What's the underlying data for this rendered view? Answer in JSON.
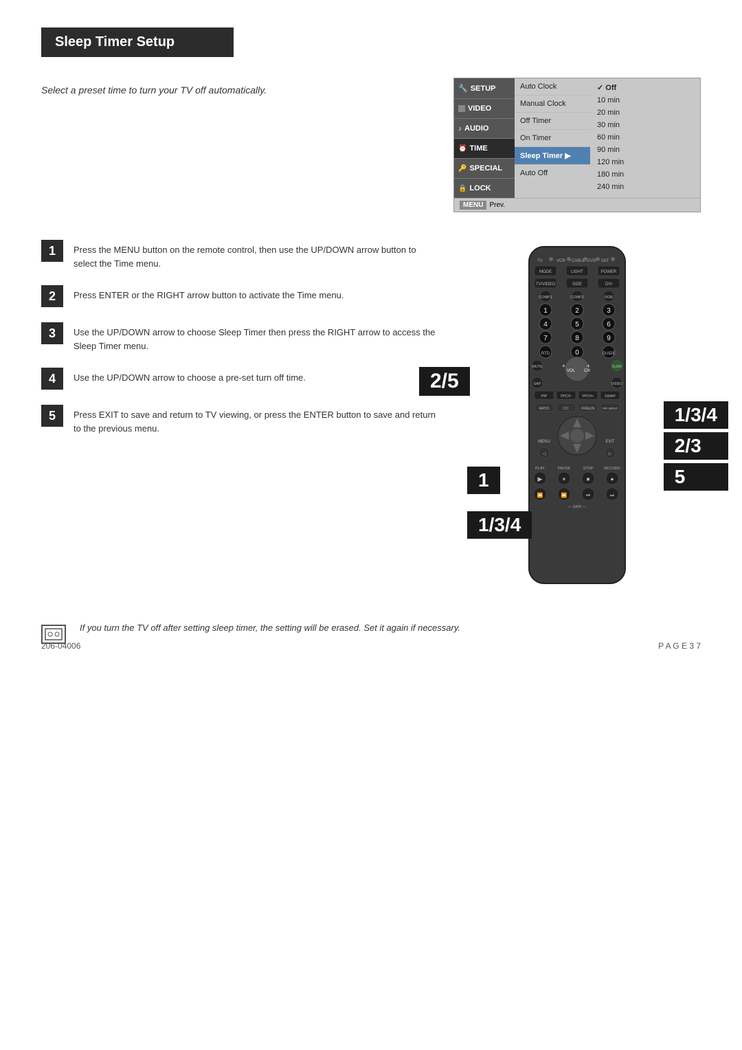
{
  "page": {
    "title": "Sleep Timer Setup",
    "intro_text": "Select a preset time to turn your TV off automatically.",
    "footer_left": "206-04006",
    "footer_right": "P A G E   3 7"
  },
  "tv_menu": {
    "nav_items": [
      {
        "id": "setup",
        "label": "SETUP",
        "icon": "wrench"
      },
      {
        "id": "video",
        "label": "VIDEO",
        "icon": "square"
      },
      {
        "id": "audio",
        "label": "AUDIO",
        "icon": "note"
      },
      {
        "id": "time",
        "label": "TIME",
        "icon": "clock",
        "active": true
      },
      {
        "id": "special",
        "label": "SPECIAL",
        "icon": "star"
      },
      {
        "id": "lock",
        "label": "LOCK",
        "icon": "lock"
      }
    ],
    "options": [
      {
        "label": "Auto Clock"
      },
      {
        "label": "Manual Clock"
      },
      {
        "label": "Off Timer"
      },
      {
        "label": "On Timer"
      },
      {
        "label": "Sleep Timer",
        "active": true,
        "arrow": true
      },
      {
        "label": "Auto Off"
      }
    ],
    "values": [
      {
        "label": "Off",
        "checked": true
      },
      {
        "label": "10 min"
      },
      {
        "label": "20 min"
      },
      {
        "label": "30 min"
      },
      {
        "label": "60 min"
      },
      {
        "label": "90 min"
      },
      {
        "label": "120 min"
      },
      {
        "label": "180 min"
      },
      {
        "label": "240 min"
      }
    ],
    "footer_menu": "MENU",
    "footer_prev": "Prev."
  },
  "steps": [
    {
      "number": "1",
      "text": "Press the MENU button on the remote control, then use the UP/DOWN arrow button to select the Time menu."
    },
    {
      "number": "2",
      "text": "Press ENTER or the RIGHT arrow button to activate the Time menu."
    },
    {
      "number": "3",
      "text": "Use the UP/DOWN arrow to choose Sleep Timer then press the RIGHT arrow to access the Sleep Timer menu."
    },
    {
      "number": "4",
      "text": "Use the UP/DOWN arrow to choose a pre-set turn off time."
    },
    {
      "number": "5",
      "text": "Press EXIT to save and return to TV viewing, or press the ENTER button to save and return to the previous menu."
    }
  ],
  "remote_step_badges": {
    "badge_2_5": "2/5",
    "badge_1_3_4": "1/3/4",
    "badge_2_3": "2/3",
    "badge_5": "5",
    "badge_1": "1",
    "badge_bottom_1_3_4": "1/3/4"
  },
  "note": {
    "text": "If you turn the TV off after setting sleep timer, the setting will be erased. Set it again if necessary."
  },
  "remote": {
    "top_labels": [
      "TV",
      "VCR",
      "CABLE",
      "DVD",
      "SAT"
    ],
    "buttons_row1": [
      "MODE",
      "LIGHT",
      "POWER"
    ],
    "buttons_row2": [
      "TV/VIDEO",
      "SIDE",
      "DVI"
    ],
    "buttons_row3": [
      "COMP1",
      "COMP2",
      "RGB"
    ],
    "numbers": [
      "1",
      "2",
      "3",
      "4",
      "5",
      "6",
      "7",
      "8",
      "9"
    ],
    "special_row": [
      "RTD",
      "0",
      "GUIDE"
    ],
    "buttons_mid": [
      "MUTE",
      "VOL+",
      "CH+",
      "SURF",
      "SAP",
      "VIDEO"
    ],
    "buttons_bot1": [
      "PIP",
      "PPCH-",
      "PPCH+",
      "SWAP"
    ],
    "buttons_bot2": [
      "RATIO",
      "CC",
      "FREEZE",
      "PIP INPUT"
    ],
    "nav_labels": [
      "MENU",
      "EXIT"
    ],
    "transport": [
      "PLAY",
      "PAUSE",
      "STOP",
      "RECORD"
    ],
    "transport2": [
      "REW",
      "FF",
      "SKIP-",
      "SKIP+"
    ]
  }
}
